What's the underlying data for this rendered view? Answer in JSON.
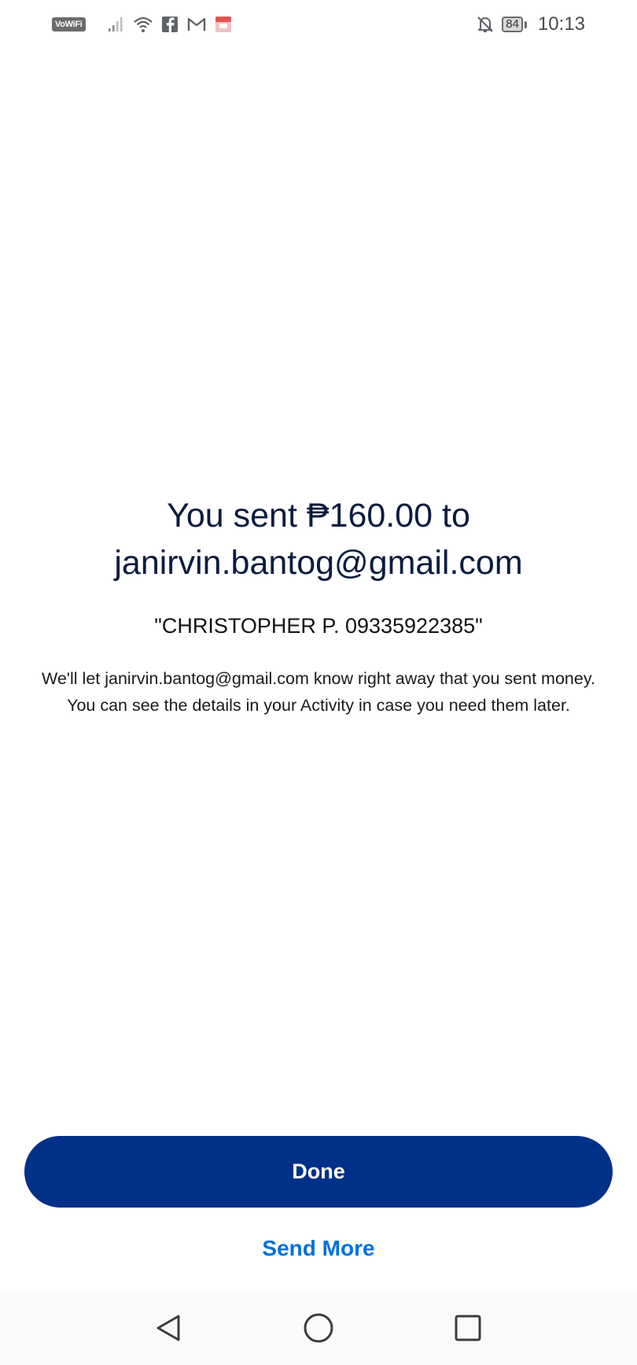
{
  "status_bar": {
    "vowifi": "VoWiFi",
    "battery_level": "84",
    "time": "10:13",
    "icons": [
      "signal-icon",
      "wifi-icon",
      "facebook-icon",
      "gmail-icon",
      "app-icon",
      "bell-off-icon",
      "battery-icon"
    ]
  },
  "confirmation": {
    "headline_line1": "You sent ₱160.00 to",
    "headline_line2": "janirvin.bantog@gmail.com",
    "note": "\"CHRISTOPHER P. 09335922385\"",
    "description": "We'll let janirvin.bantog@gmail.com know right away that you sent money. You can see the details in your Activity in case you need them later."
  },
  "actions": {
    "done_label": "Done",
    "send_more_label": "Send More"
  },
  "navigation": {
    "icons": [
      "back-icon",
      "home-icon",
      "recents-icon"
    ]
  },
  "colors": {
    "primary_button": "#003087",
    "link": "#0070e0",
    "heading_text": "#0b1c3f"
  }
}
